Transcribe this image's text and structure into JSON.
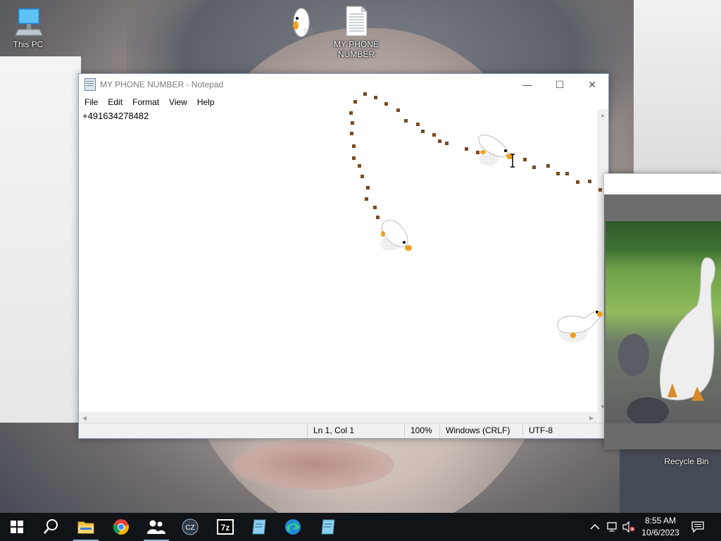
{
  "desktop": {
    "icons": [
      {
        "label": "This PC",
        "icon": "computer-icon"
      },
      {
        "label": "MY PHONE\nNUMBER",
        "icon": "text-document-icon"
      },
      {
        "label": "Recycle Bin",
        "icon": "recycle-bin-icon"
      }
    ]
  },
  "notepad": {
    "title": "MY PHONE NUMBER - Notepad",
    "menu": [
      "File",
      "Edit",
      "Format",
      "View",
      "Help"
    ],
    "content": "+491634278482",
    "status": {
      "position": "Ln 1, Col 1",
      "zoom": "100%",
      "line_endings": "Windows (CRLF)",
      "encoding": "UTF-8"
    },
    "controls": {
      "minimize": "—",
      "maximize": "☐",
      "close": "✕"
    }
  },
  "taskbar": {
    "apps": [
      {
        "name": "start-button",
        "icon": "windows-logo-icon"
      },
      {
        "name": "search-button",
        "icon": "search-icon"
      },
      {
        "name": "file-explorer",
        "icon": "folder-icon"
      },
      {
        "name": "chrome",
        "icon": "chrome-icon"
      },
      {
        "name": "people",
        "icon": "people-icon"
      },
      {
        "name": "cz-app",
        "icon": "cz-icon"
      },
      {
        "name": "7zip",
        "icon": "7zip-icon"
      },
      {
        "name": "notepad-app-1",
        "icon": "notepad-icon"
      },
      {
        "name": "edge",
        "icon": "edge-icon"
      },
      {
        "name": "notepad-app-2",
        "icon": "notepad-icon"
      }
    ],
    "clock": {
      "time": "8:55 AM",
      "date": "10/6/2023"
    },
    "tray_icons": [
      "chevron-up-icon",
      "network-icon",
      "volume-muted-icon",
      "notification-icon"
    ]
  },
  "colors": {
    "taskbar": "#101318",
    "goose_beak": "#f0a01c",
    "footprints": "#7a4a22",
    "active_indicator": "#8ab4d8"
  }
}
